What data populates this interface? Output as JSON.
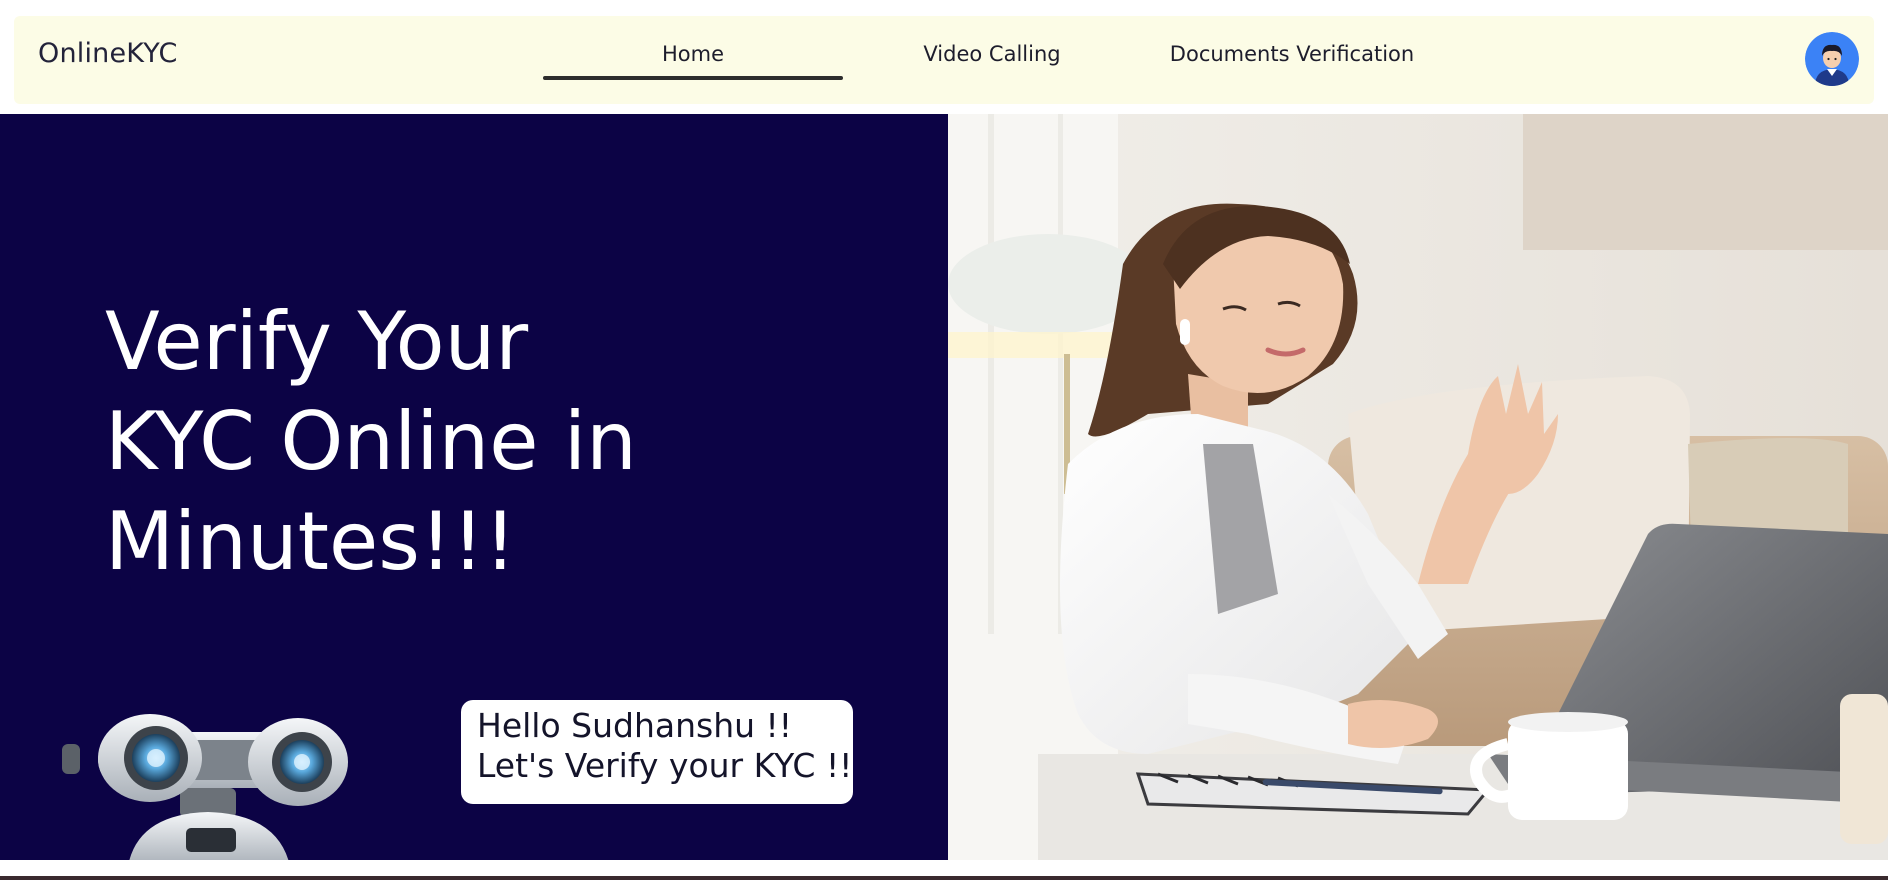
{
  "brand": "OnlineKYC",
  "nav": {
    "home": "Home",
    "video": "Video Calling",
    "docs": "Documents Verification"
  },
  "hero": {
    "line1": "Verify Your",
    "line2": "KYC Online in",
    "line3": "Minutes!!!"
  },
  "speech": {
    "line1": "Hello Sudhanshu !!",
    "line2": "Let's Verify your KYC !!"
  },
  "colors": {
    "navbar_bg": "#fcfce6",
    "hero_bg": "#0c0345",
    "avatar_bg": "#3b82f6"
  }
}
